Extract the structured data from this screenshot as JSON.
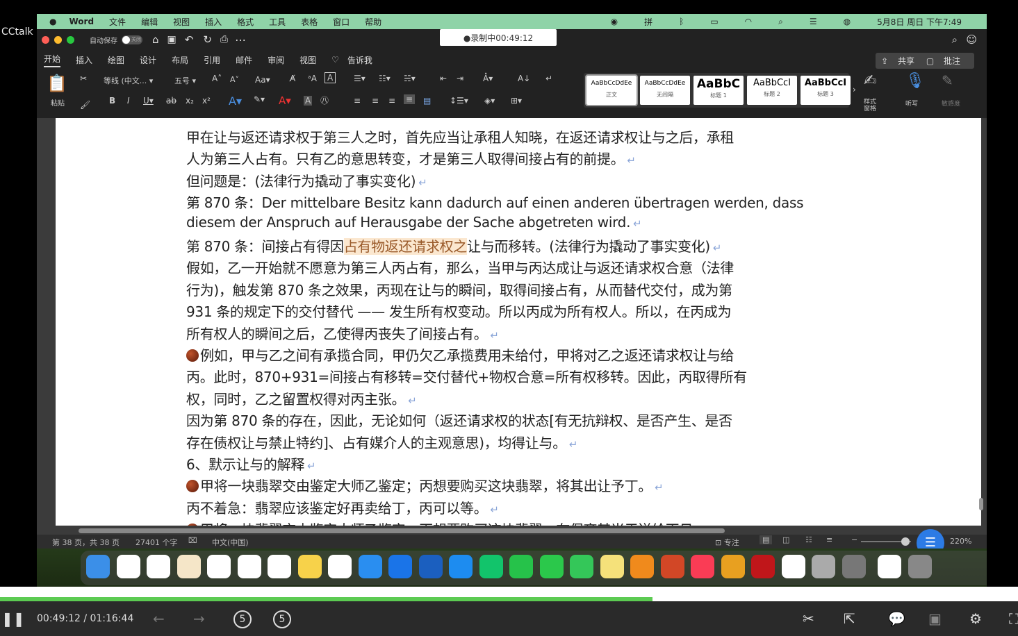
{
  "overlay": {
    "app_label": "CCtalk",
    "recording": "●录制中00:49:12"
  },
  "menubar": {
    "app": "Word",
    "items": [
      "文件",
      "编辑",
      "视图",
      "插入",
      "格式",
      "工具",
      "表格",
      "窗口",
      "帮助"
    ],
    "clock": "5月8日 周日 下午7:49"
  },
  "titlebar": {
    "autosave": "自动保存",
    "autosave_state": "关闭"
  },
  "ribbon": {
    "tabs": [
      "开始",
      "插入",
      "绘图",
      "设计",
      "布局",
      "引用",
      "邮件",
      "审阅",
      "视图"
    ],
    "tell_me": "告诉我",
    "paste": "粘贴",
    "font_name": "等线 (中文...",
    "font_size": "五号",
    "share": "共享",
    "comments": "批注",
    "styles": [
      {
        "sample": "AaBbCcDdEe",
        "name": "正文"
      },
      {
        "sample": "AaBbCcDdEe",
        "name": "无间隔"
      },
      {
        "sample": "AaBbC",
        "name": "标题 1"
      },
      {
        "sample": "AaBbCcI",
        "name": "标题 2"
      },
      {
        "sample": "AaBbCcI",
        "name": "标题 3"
      }
    ],
    "styles_pane": "样式窗格",
    "dictate": "听写",
    "sensitivity": "敏感度"
  },
  "document": {
    "lines": [
      {
        "text": "甲在让与返还请求权于第三人之时，首先应当让承租人知晓，在返还请求权让与之后，承租"
      },
      {
        "text": "人为第三人占有。只有乙的意思转变，才是第三人取得间接占有的前提。",
        "ret": true
      },
      {
        "text": "但问题是：(法律行为撬动了事实变化)",
        "ret": true
      },
      {
        "text": "第 870 条：Der mittelbare Besitz kann dadurch auf einen anderen übertragen werden, dass"
      },
      {
        "text": "diesem der Anspruch auf Herausgabe der Sache abgetreten wird.",
        "ret": true
      },
      {
        "pre": "第 870 条：间接占有得因",
        "highlight": "占有物返还请求权之",
        "text": "让与而移转。(法律行为撬动了事实变化)",
        "ret": true
      },
      {
        "text": "假如，乙一开始就不愿意为第三人丙占有，那么，当甲与丙达成让与返还请求权合意（法律"
      },
      {
        "text": "行为)，触发第 870 条之效果，丙现在让与的瞬间，取得间接占有，从而替代交付，成为第"
      },
      {
        "text": "931 条的规定下的交付替代 —— 发生所有权变动。所以丙成为所有权人。所以，在丙成为"
      },
      {
        "text": "所有权人的瞬间之后，乙使得丙丧失了间接占有。",
        "ret": true
      },
      {
        "text": "例如，甲与乙之间有承揽合同，甲仍欠乙承揽费用未给付，甲将对乙之返还请求权让与给",
        "bullet": true
      },
      {
        "text": "丙。此时，870+931=间接占有移转=交付替代+物权合意=所有权移转。因此，丙取得所有"
      },
      {
        "text": "权，同时，乙之留置权得对丙主张。",
        "ret": true
      },
      {
        "text": "因为第 870 条的存在，因此，无论如何（返还请求权的状态[有无抗辩权、是否产生、是否"
      },
      {
        "text": "存在债权让与禁止特约]、占有媒介人的主观意思)，均得让与。",
        "ret": true
      },
      {
        "text": "6、默示让与的解释",
        "ret": true
      },
      {
        "text": "甲将一块翡翠交由鉴定大师乙鉴定；丙想要购买这块翡翠，将其出让予丁。",
        "bullet": true,
        "ret": true
      },
      {
        "text": "丙不着急：翡翠应该鉴定好再卖给丁，丙可以等。",
        "ret": true
      },
      {
        "text": "甲将一块翡翠交由鉴定大师乙鉴定；丙想要购买这块翡翠，在保齐其当于送给丙日",
        "bullet": true
      }
    ],
    "return_mark": "↵"
  },
  "statusbar": {
    "page": "第 38 页，共 38 页",
    "words": "27401 个字",
    "language": "中文(中国)",
    "focus": "专注",
    "zoom": "220%"
  },
  "player": {
    "time": "00:49:12 / 01:16:44",
    "progress": 0.641,
    "back_label": "5",
    "fwd_label": "5"
  }
}
